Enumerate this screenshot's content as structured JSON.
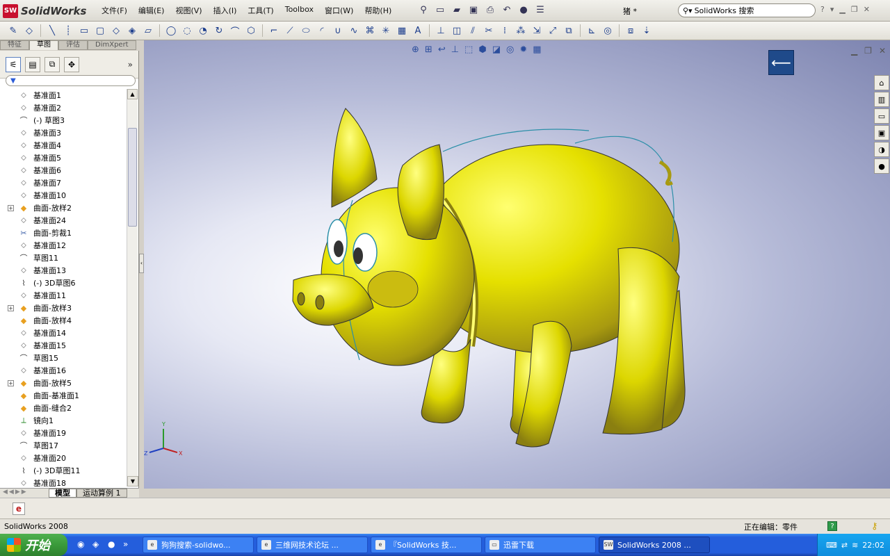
{
  "app": {
    "name": "SolidWorks",
    "document_title": "猪 *"
  },
  "menu": [
    "文件(F)",
    "编辑(E)",
    "视图(V)",
    "插入(I)",
    "工具(T)",
    "Toolbox",
    "窗口(W)",
    "帮助(H)"
  ],
  "search": {
    "placeholder": "SolidWorks 搜索"
  },
  "help_label": "?",
  "cm_tabs": [
    "特征",
    "草图",
    "评估",
    "DimXpert"
  ],
  "tree": [
    {
      "label": "基准面1",
      "icon": "plane"
    },
    {
      "label": "基准面2",
      "icon": "plane"
    },
    {
      "label": "(-) 草图3",
      "icon": "sketch"
    },
    {
      "label": "基准面3",
      "icon": "plane"
    },
    {
      "label": "基准面4",
      "icon": "plane"
    },
    {
      "label": "基准面5",
      "icon": "plane"
    },
    {
      "label": "基准面6",
      "icon": "plane"
    },
    {
      "label": "基准面7",
      "icon": "plane"
    },
    {
      "label": "基准面10",
      "icon": "plane"
    },
    {
      "label": "曲面-放样2",
      "icon": "loft",
      "expandable": true
    },
    {
      "label": "基准面24",
      "icon": "plane"
    },
    {
      "label": "曲面-剪裁1",
      "icon": "trim"
    },
    {
      "label": "基准面12",
      "icon": "plane"
    },
    {
      "label": "草图11",
      "icon": "sketch"
    },
    {
      "label": "基准面13",
      "icon": "plane"
    },
    {
      "label": "(-) 3D草图6",
      "icon": "sketch3d"
    },
    {
      "label": "基准面11",
      "icon": "plane"
    },
    {
      "label": "曲面-放样3",
      "icon": "loft",
      "expandable": true
    },
    {
      "label": "曲面-放样4",
      "icon": "loft"
    },
    {
      "label": "基准面14",
      "icon": "plane"
    },
    {
      "label": "基准面15",
      "icon": "plane"
    },
    {
      "label": "草图15",
      "icon": "sketch"
    },
    {
      "label": "基准面16",
      "icon": "plane"
    },
    {
      "label": "曲面-放样5",
      "icon": "loft",
      "expandable": true
    },
    {
      "label": "曲面-基准面1",
      "icon": "loft"
    },
    {
      "label": "曲面-缝合2",
      "icon": "loft"
    },
    {
      "label": "镜向1",
      "icon": "mirror"
    },
    {
      "label": "基准面19",
      "icon": "plane"
    },
    {
      "label": "草图17",
      "icon": "sketch"
    },
    {
      "label": "基准面20",
      "icon": "plane"
    },
    {
      "label": "(-) 3D草图11",
      "icon": "sketch3d"
    },
    {
      "label": "基准面18",
      "icon": "plane"
    }
  ],
  "bottom_tabs": [
    "模型",
    "运动算例 1"
  ],
  "status": {
    "left": "SolidWorks 2008",
    "editing": "正在编辑：零件"
  },
  "taskbar": {
    "start": "开始",
    "tasks": [
      "狗狗搜索-solidwo...",
      "三维网技术论坛 ...",
      "『SolidWorks 技...",
      "迅雷下载",
      "SolidWorks 2008 ..."
    ],
    "clock": "22:02"
  },
  "triad": {
    "x": "X",
    "y": "Y",
    "z": "Z"
  },
  "colors": {
    "model": "#e5e000",
    "model_edge": "#2b8fa8",
    "accent": "#245edc"
  }
}
